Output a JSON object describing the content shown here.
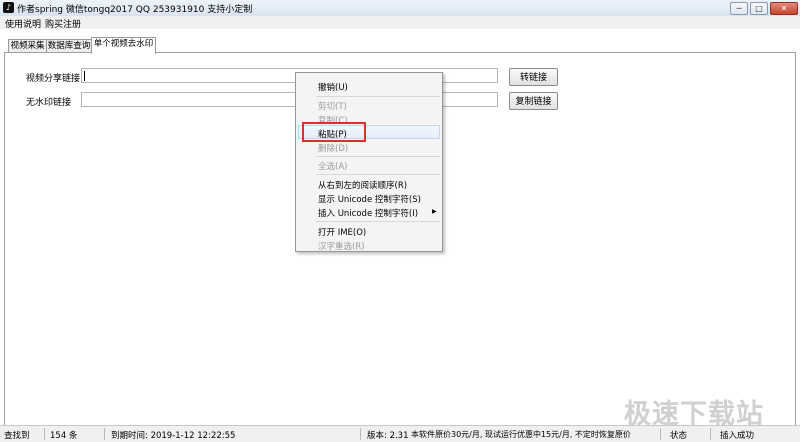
{
  "window": {
    "title": "作者spring 微信tongq2017  QQ 253931910 支持小定制",
    "app_icon": "tiktok-icon",
    "controls": {
      "minimize": "─",
      "maximize": "□",
      "close": "✕"
    }
  },
  "menubar": {
    "items": [
      "使用说明",
      "购买注册"
    ]
  },
  "tabs": [
    "视频采集",
    "数据库查询",
    "单个视频去水印"
  ],
  "active_tab": "单个视频去水印",
  "form": {
    "share_link_label": "视频分享链接",
    "share_link_value": "",
    "nowatermark_label": "无水印链接",
    "nowatermark_value": "",
    "convert_button": "转链接",
    "copy_button": "复制链接"
  },
  "context_menu": {
    "items": [
      {
        "label": "撤销(U)",
        "enabled": true
      },
      {
        "label": "剪切(T)",
        "enabled": false
      },
      {
        "label": "复制(C)",
        "enabled": false
      },
      {
        "label": "粘贴(P)",
        "enabled": true,
        "highlighted": true
      },
      {
        "label": "删除(D)",
        "enabled": false
      },
      {
        "label": "全选(A)",
        "enabled": false
      },
      {
        "label": "从右到左的阅读顺序(R)",
        "enabled": true
      },
      {
        "label": "显示 Unicode 控制字符(S)",
        "enabled": true
      },
      {
        "label": "插入 Unicode 控制字符(I)",
        "enabled": true,
        "submenu": true
      },
      {
        "label": "打开 IME(O)",
        "enabled": true
      },
      {
        "label": "汉字重选(R)",
        "enabled": false
      }
    ],
    "submenu_arrow": "▶",
    "highlight_color": "#d8302c"
  },
  "statusbar": {
    "found_label": "查找到",
    "found_count": "154 条",
    "expiry": "到期时间: 2019-1-12 12:22:55",
    "version": "版本: 2.31",
    "price_note": "本软件原价30元/月, 现试运行优惠中15元/月, 不定时恢复原价",
    "state_label": "状态",
    "state_value": "插入成功"
  },
  "watermark": "极速下载站"
}
